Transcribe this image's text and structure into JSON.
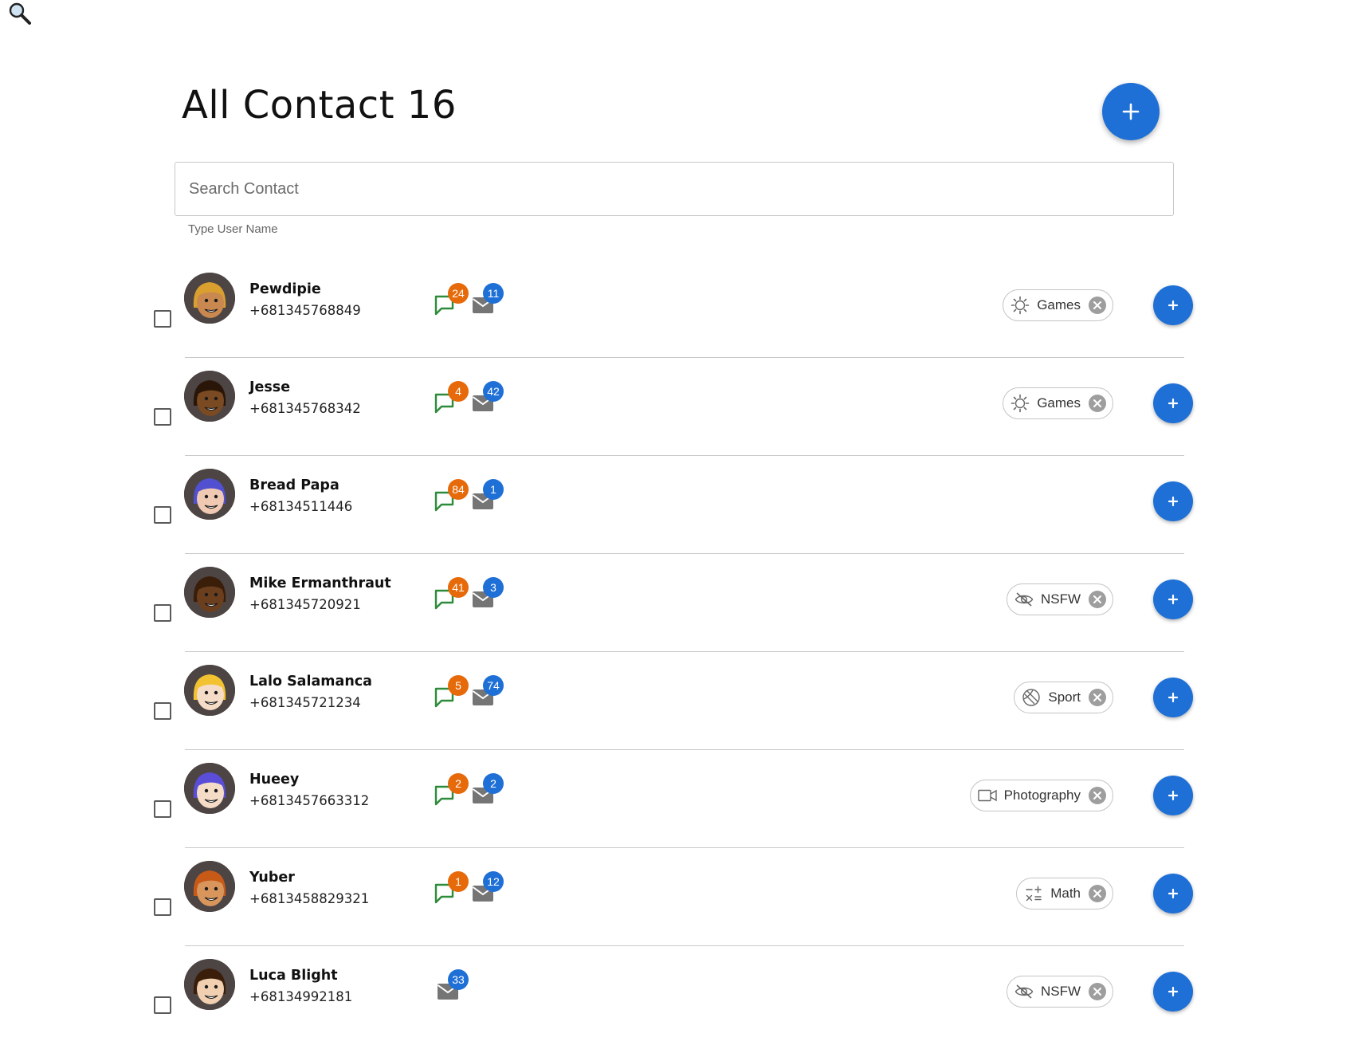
{
  "header": {
    "title": "All Contact 16"
  },
  "search": {
    "placeholder": "Search Contact",
    "value": "",
    "helper": "Type User Name"
  },
  "colors": {
    "accent": "#1e70d6",
    "badge_chat": "#e66a0a",
    "badge_mail": "#1e70d6",
    "chat_icon": "#2e8b3a",
    "mail_icon": "#757575"
  },
  "contacts": [
    {
      "name": "Pewdipie",
      "phone": "+681345768849",
      "chat_count": "24",
      "mail_count": "11",
      "tag": {
        "label": "Games",
        "icon": "gear-icon"
      },
      "avatar": {
        "skin": "#c8884f",
        "hair": "#d9a030"
      }
    },
    {
      "name": "Jesse",
      "phone": "+681345768342",
      "chat_count": "4",
      "mail_count": "42",
      "tag": {
        "label": "Games",
        "icon": "gear-icon"
      },
      "avatar": {
        "skin": "#7a4a22",
        "hair": "#2a1608"
      }
    },
    {
      "name": "Bread Papa",
      "phone": "+68134511446",
      "chat_count": "84",
      "mail_count": "1",
      "tag": null,
      "avatar": {
        "skin": "#f0c9b2",
        "hair": "#5050d0"
      }
    },
    {
      "name": "Mike Ermanthraut",
      "phone": "+681345720921",
      "chat_count": "41",
      "mail_count": "3",
      "tag": {
        "label": "NSFW",
        "icon": "eye-off-icon"
      },
      "avatar": {
        "skin": "#6b3f1e",
        "hair": "#3a1e0a"
      }
    },
    {
      "name": "Lalo Salamanca",
      "phone": "+681345721234",
      "chat_count": "5",
      "mail_count": "74",
      "tag": {
        "label": "Sport",
        "icon": "ball-icon"
      },
      "avatar": {
        "skin": "#f5dcc6",
        "hair": "#f2c230"
      }
    },
    {
      "name": "Hueey",
      "phone": "+6813457663312",
      "chat_count": "2",
      "mail_count": "2",
      "tag": {
        "label": "Photography",
        "icon": "video-camera-icon"
      },
      "avatar": {
        "skin": "#f5dcc6",
        "hair": "#5a4ed8"
      }
    },
    {
      "name": "Yuber",
      "phone": "+6813458829321",
      "chat_count": "1",
      "mail_count": "12",
      "tag": {
        "label": "Math",
        "icon": "math-icon"
      },
      "avatar": {
        "skin": "#d8955c",
        "hair": "#c85a18"
      }
    },
    {
      "name": "Luca Blight",
      "phone": "+68134992181",
      "chat_count": null,
      "mail_count": "33",
      "tag": {
        "label": "NSFW",
        "icon": "eye-off-icon"
      },
      "avatar": {
        "skin": "#f0d0b0",
        "hair": "#3a1e0a"
      }
    }
  ]
}
